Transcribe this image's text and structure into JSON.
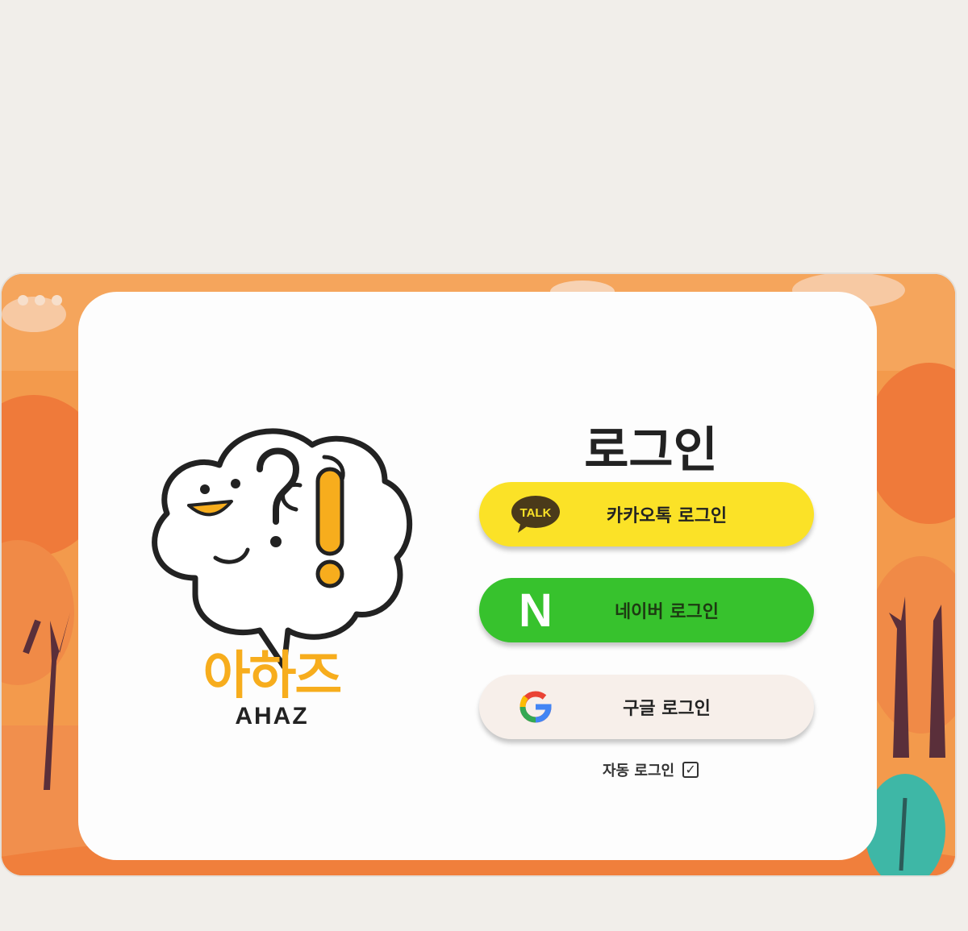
{
  "login": {
    "title": "로그인",
    "kakao_label": "카카오톡 로그인",
    "kakao_icon_text": "TALK",
    "naver_label": "네이버 로그인",
    "naver_icon_text": "N",
    "google_label": "구글 로그인",
    "google_icon_text": "G",
    "auto_login_label": "자동 로그인",
    "auto_login_checked": true,
    "checkbox_mark": "✓"
  },
  "brand": {
    "name_ko": "아하즈",
    "name_en": "AHAZ"
  },
  "colors": {
    "kakao": "#fbe227",
    "naver": "#37c22d",
    "google_bg": "#f7efea",
    "brand_yellow": "#f7ad1d",
    "background_orange": "#f39a4c"
  }
}
